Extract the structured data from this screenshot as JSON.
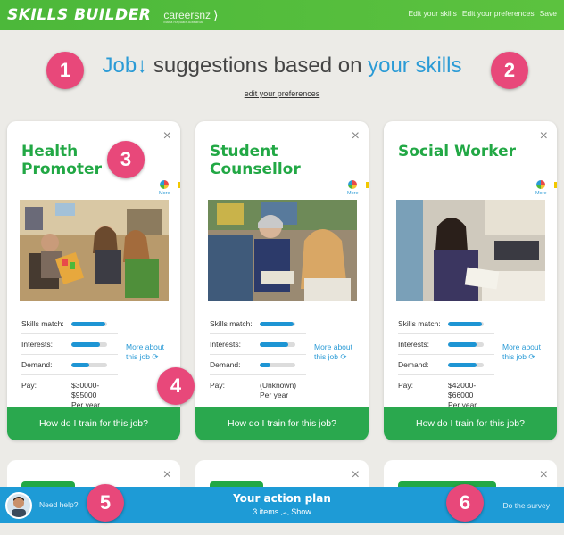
{
  "header": {
    "logo": "SKILLS BUILDER",
    "careers": "careersnz",
    "careers_sub": "Mana Rapuara Aotearoa",
    "nav": [
      "Edit your skills",
      "Edit your preferences",
      "Save"
    ]
  },
  "title": {
    "job_link": "Job↓",
    "middle": " suggestions based on ",
    "skills_link": "your skills",
    "edit_preferences": "edit your preferences"
  },
  "badges": [
    "1",
    "2",
    "3",
    "4",
    "5",
    "6"
  ],
  "labels": {
    "skills_match": "Skills match:",
    "interests": "Interests:",
    "demand": "Demand:",
    "pay": "Pay:",
    "more_about": "More about this job",
    "train": "How do I train for this job?",
    "more": "More",
    "close": "×"
  },
  "cards": [
    {
      "title": "Health Promoter",
      "skills_match": 0.95,
      "interests": 0.8,
      "demand": 0.5,
      "pay": [
        "$30000-",
        "$95000",
        "Per year"
      ]
    },
    {
      "title": "Student Counsellor",
      "skills_match": 0.95,
      "interests": 0.8,
      "demand": 0.3,
      "pay": [
        "(Unknown)",
        "Per year"
      ]
    },
    {
      "title": "Social Worker",
      "skills_match": 0.95,
      "interests": 0.8,
      "demand": 0.8,
      "pay": [
        "$42000-",
        "$66000",
        "Per year"
      ]
    }
  ],
  "footer": {
    "need_help": "Need help?",
    "plan_title": "Your action plan",
    "items": "3 items",
    "show": "Show",
    "survey": "Do the survey"
  },
  "colors": {
    "brand_green": "#4cb83a",
    "title_green": "#22a845",
    "link_blue": "#2b9bd6",
    "bar_blue": "#1e95d4",
    "badge_pink": "#e8487a",
    "footer_blue": "#1e9bd6"
  }
}
